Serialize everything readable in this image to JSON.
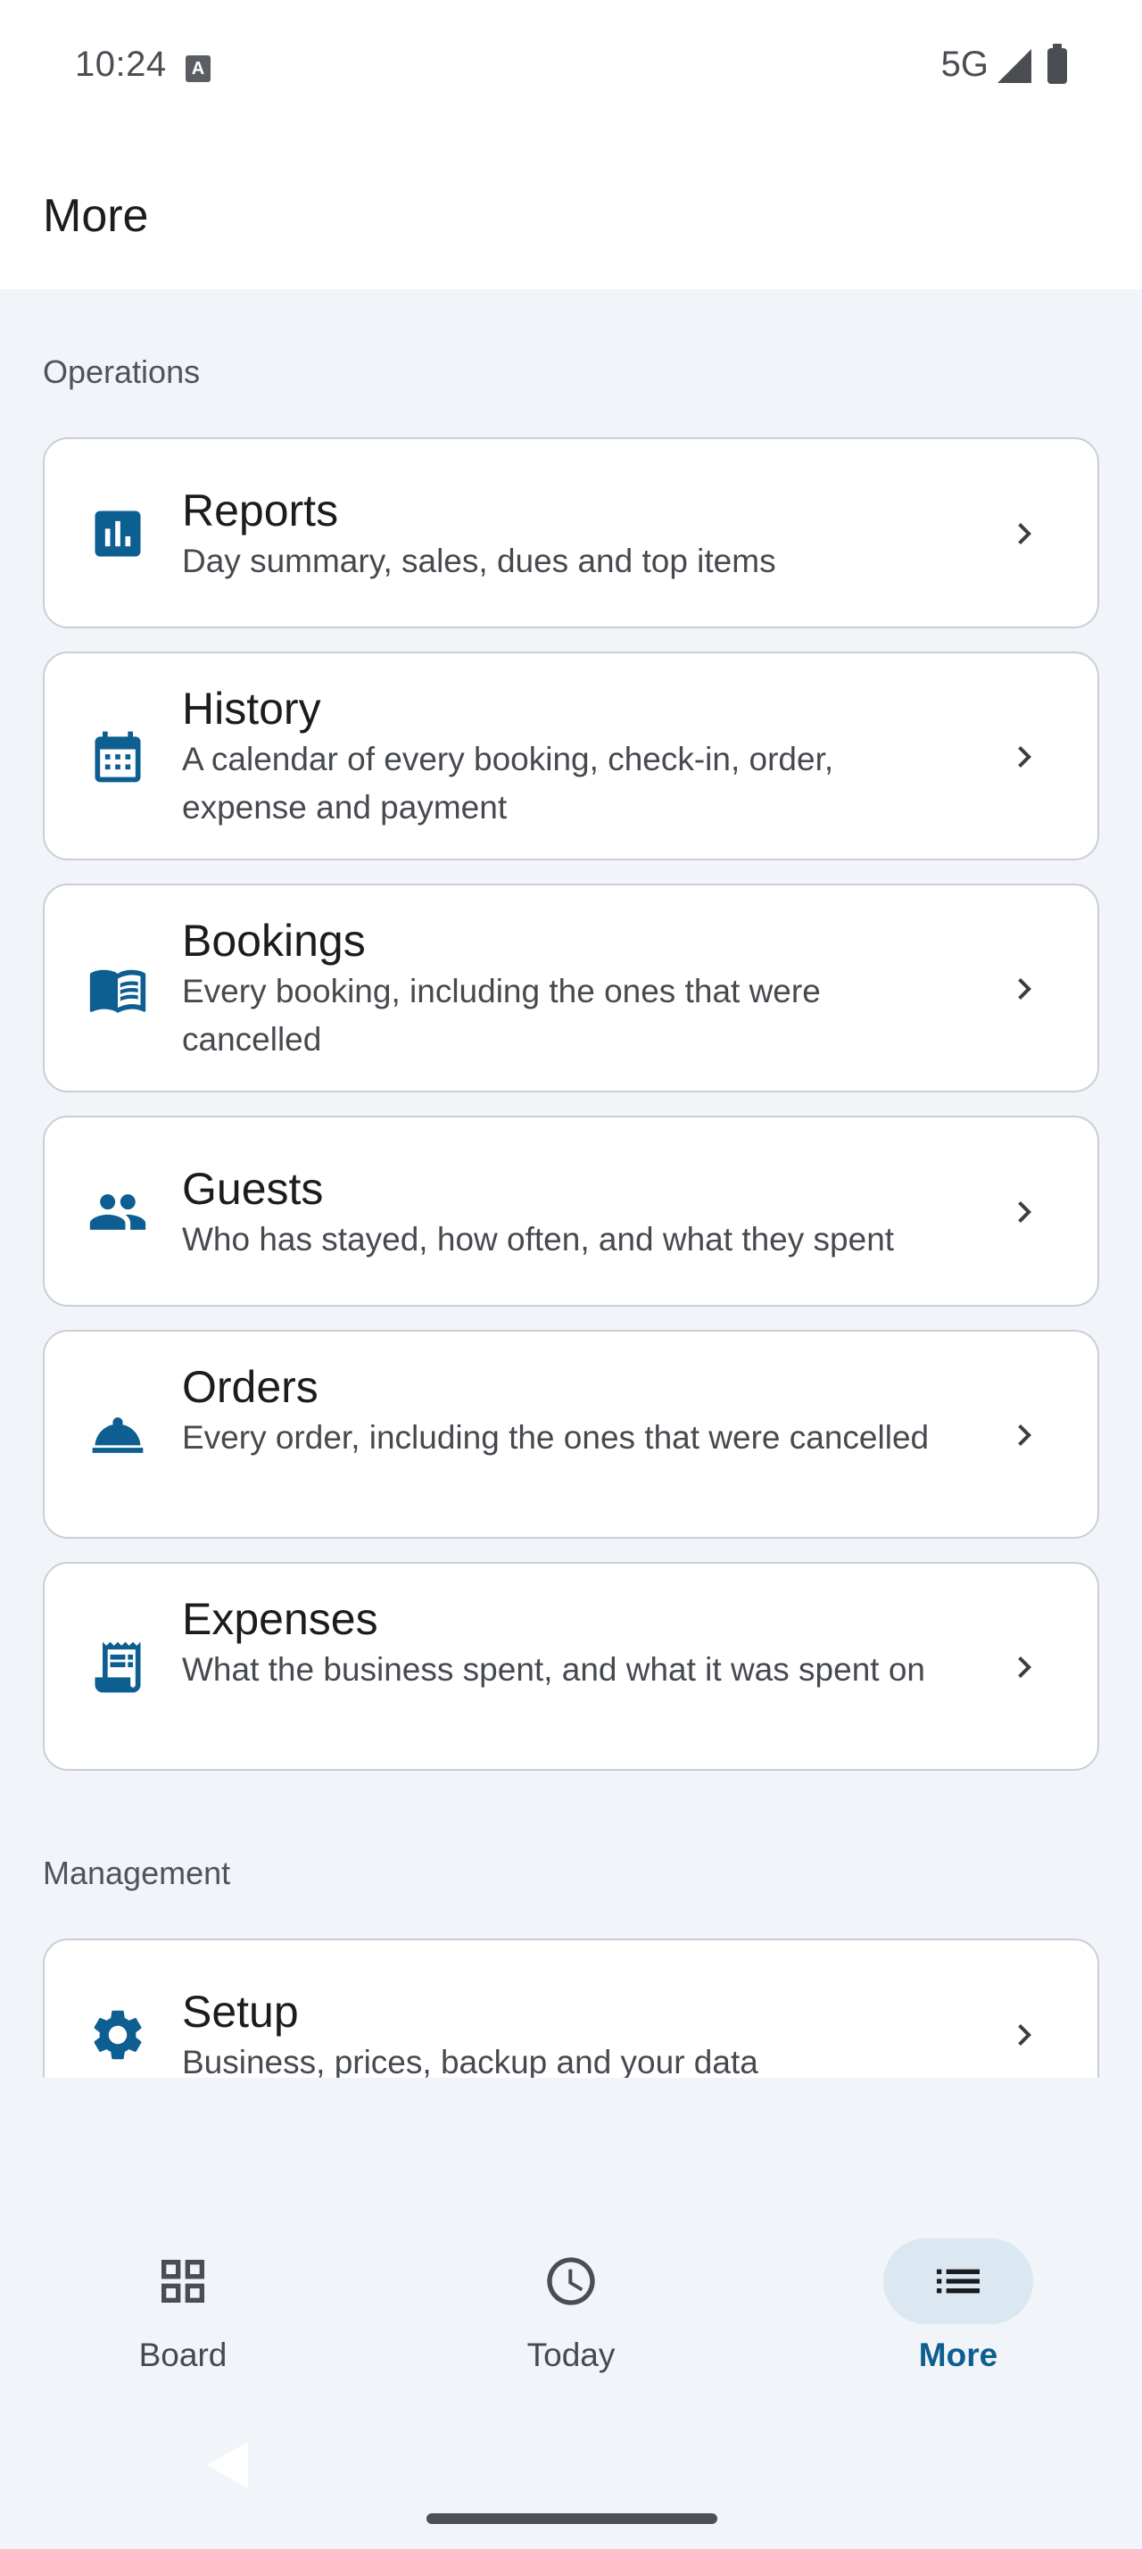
{
  "status_bar": {
    "time": "10:24",
    "keyboard_indicator": "A",
    "network": "5G"
  },
  "app_bar": {
    "title": "More"
  },
  "sections": {
    "operations": {
      "title": "Operations",
      "items": [
        {
          "icon": "bar-chart-icon",
          "title": "Reports",
          "description": "Day summary, sales, dues and top items"
        },
        {
          "icon": "calendar-icon",
          "title": "History",
          "description": "A calendar of every booking, check-in, order, expense and payment"
        },
        {
          "icon": "open-book-icon",
          "title": "Bookings",
          "description": "Every booking, including the ones that were cancelled"
        },
        {
          "icon": "people-icon",
          "title": "Guests",
          "description": "Who has stayed, how often, and what they spent"
        },
        {
          "icon": "room-service-icon",
          "title": "Orders",
          "description": "Every order, including the ones that were cancelled"
        },
        {
          "icon": "receipt-icon",
          "title": "Expenses",
          "description": "What the business spent, and what it was spent on"
        }
      ]
    },
    "management": {
      "title": "Management",
      "items": [
        {
          "icon": "gear-icon",
          "title": "Setup",
          "description": "Business, prices, backup and your data"
        }
      ]
    }
  },
  "bottom_nav": {
    "items": [
      {
        "label": "Board",
        "icon": "grid-icon",
        "active": false
      },
      {
        "label": "Today",
        "icon": "clock-icon",
        "active": false
      },
      {
        "label": "More",
        "icon": "list-icon",
        "active": true
      }
    ]
  },
  "colors": {
    "accent": "#0d5e91",
    "background": "#f1f4f9",
    "card_border": "#cbced4",
    "nav_active_bg": "#dbe8f2"
  }
}
